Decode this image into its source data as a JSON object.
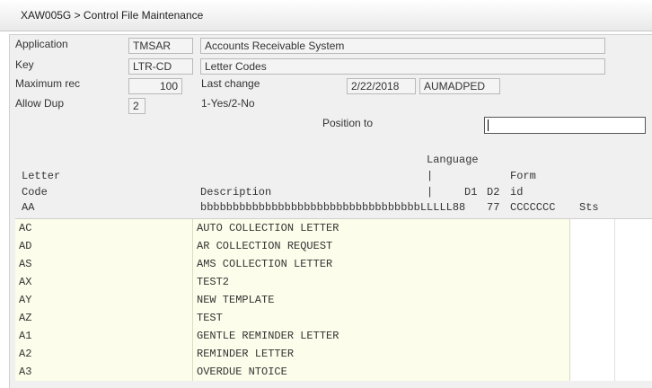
{
  "window": {
    "title": "XAW005G > Control File Maintenance"
  },
  "form": {
    "application": {
      "label": "Application",
      "code": "TMSAR",
      "name": "Accounts Receivable System"
    },
    "key": {
      "label": "Key",
      "code": "LTR-CD",
      "name": "Letter Codes"
    },
    "max_rec": {
      "label": "Maximum rec",
      "value": "100"
    },
    "last_change": {
      "label": "Last change",
      "date": "2/22/2018",
      "user": "AUMADPED"
    },
    "allow_dup": {
      "label": "Allow Dup",
      "value": "2",
      "hint": "1-Yes/2-No"
    },
    "position_to": {
      "label": "Position to",
      "value": ""
    }
  },
  "headers": {
    "language": "Language",
    "pipe1": "|",
    "pipe2": "|",
    "letter": "Letter",
    "form": "Form",
    "code": "Code",
    "description": "Description",
    "d1": "D1",
    "d2": "D2",
    "id": "id",
    "sample_code": "AA",
    "sample_desc": "bbbbbbbbbbbbbbbbbbbbbbbbbbbbbbbbbbLLLLL88",
    "sample_d2": "77",
    "sample_form": "CCCCCCC",
    "sts": "Sts"
  },
  "rows": [
    {
      "code": "AC",
      "description": "AUTO COLLECTION LETTER"
    },
    {
      "code": "AD",
      "description": "AR COLLECTION REQUEST"
    },
    {
      "code": "AS",
      "description": "AMS COLLECTION LETTER"
    },
    {
      "code": "AX",
      "description": "TEST2"
    },
    {
      "code": "AY",
      "description": "NEW TEMPLATE"
    },
    {
      "code": "AZ",
      "description": "TEST"
    },
    {
      "code": "A1",
      "description": "GENTLE REMINDER LETTER"
    },
    {
      "code": "A2",
      "description": "REMINDER LETTER"
    },
    {
      "code": "A3",
      "description": "OVERDUE NTOICE"
    }
  ]
}
